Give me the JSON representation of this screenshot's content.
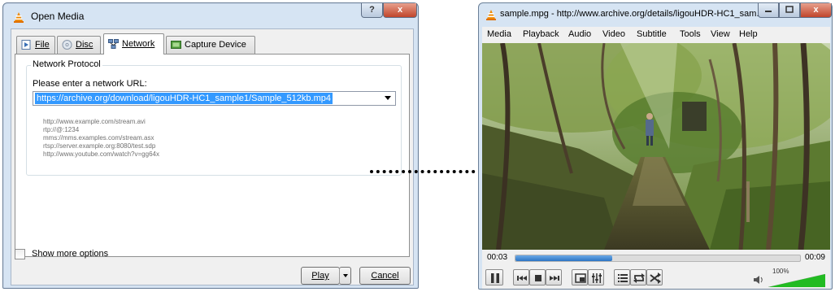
{
  "dialog": {
    "title": "Open Media",
    "help_label": "?",
    "close_label": "x",
    "tabs": [
      {
        "label": "File",
        "icon": "file-icon"
      },
      {
        "label": "Disc",
        "icon": "disc-icon"
      },
      {
        "label": "Network",
        "icon": "network-icon",
        "active": true
      },
      {
        "label": "Capture Device",
        "icon": "capture-device-icon"
      }
    ],
    "network": {
      "group_title": "Network Protocol",
      "url_label": "Please enter a network URL:",
      "url_value": "https://archive.org/download/ligouHDR-HC1_sample1/Sample_512kb.mp4",
      "examples": [
        "http://www.example.com/stream.avi",
        "rtp://@:1234",
        "mms://mms.examples.com/stream.asx",
        "rtsp://server.example.org:8080/test.sdp",
        "http://www.youtube.com/watch?v=gg64x"
      ]
    },
    "show_more_label": "Show more options",
    "play_label": "Play",
    "cancel_label": "Cancel"
  },
  "player": {
    "title": "sample.mpg - http://www.archive.org/details/ligouHDR-HC1_sam...",
    "close_label": "x",
    "menu": [
      "Media",
      "Playback",
      "Audio",
      "Video",
      "Subtitle",
      "Tools",
      "View",
      "Help"
    ],
    "elapsed": "00:03",
    "total": "00:09",
    "progress": 0.34,
    "volume_label": "100%",
    "volume": 1.0
  },
  "colors": {
    "selection": "#3399ff",
    "seek_fill": "#2c74c4",
    "volume_fill": "#22bb22",
    "close_button": "#c0452b"
  }
}
